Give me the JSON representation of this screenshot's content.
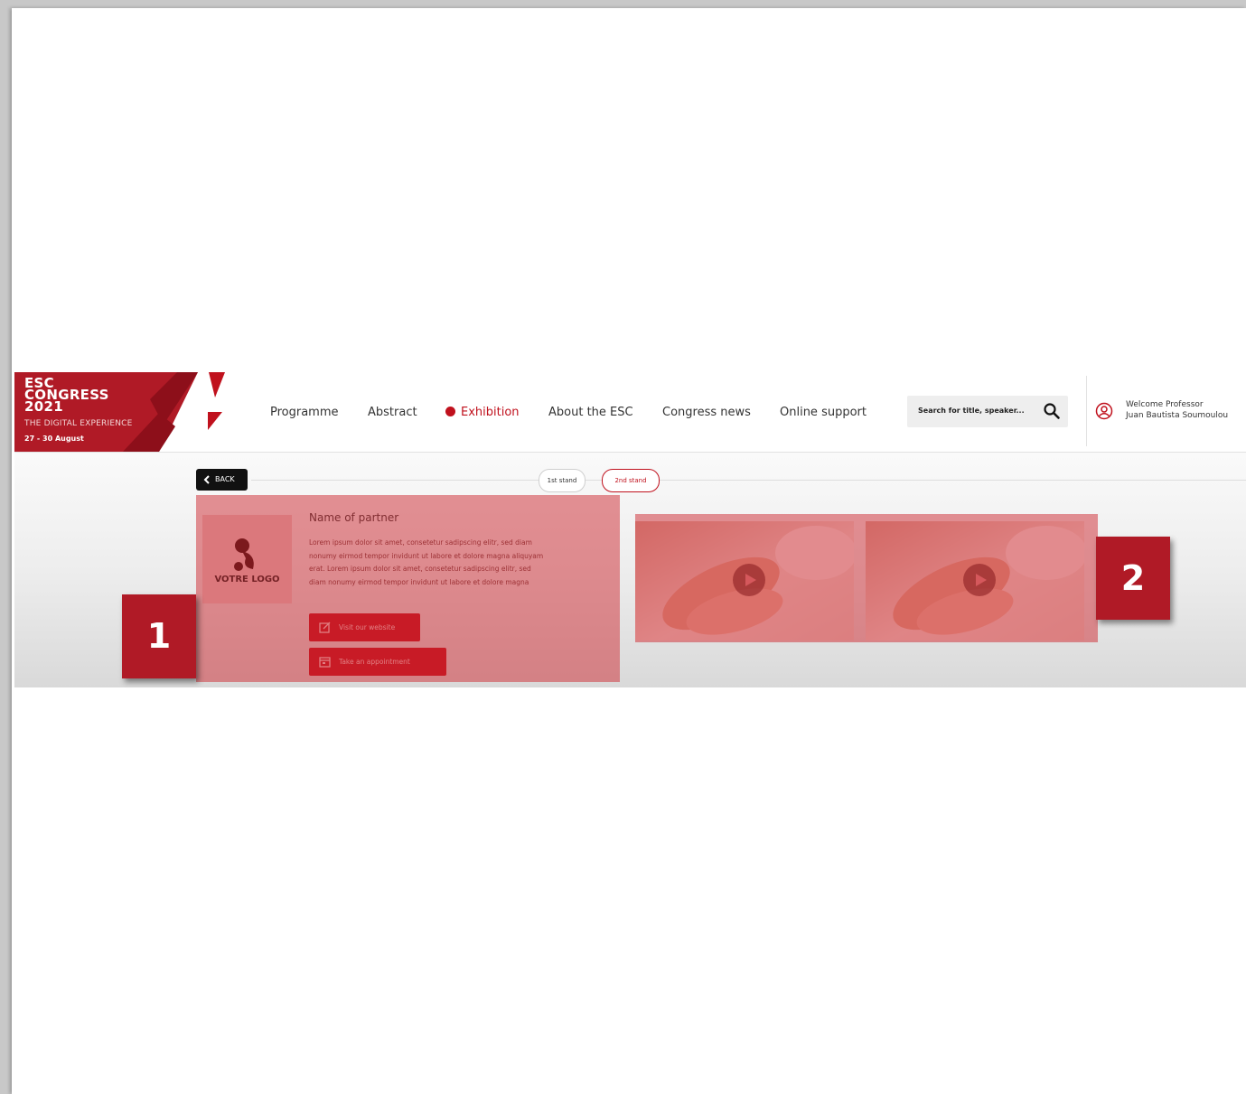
{
  "header": {
    "logo": {
      "line1": "ESC",
      "line2": "CONGRESS",
      "line3": "2021",
      "tagline": "THE DIGITAL EXPERIENCE",
      "dates": "27 - 30 August"
    },
    "nav": [
      {
        "label": "Programme"
      },
      {
        "label": "Abstract"
      },
      {
        "label": "Exhibition",
        "active": true
      },
      {
        "label": "About the ESC"
      },
      {
        "label": "Congress news"
      },
      {
        "label": "Online support"
      }
    ],
    "search": {
      "placeholder": "Search for title, speaker..."
    },
    "user": {
      "welcome": "Welcome Professor",
      "name": "Juan Bautista Soumoulou"
    }
  },
  "subbar": {
    "back_label": "BACK",
    "stand_tabs": [
      {
        "label": "1st stand"
      },
      {
        "label": "2nd stand",
        "active": true
      }
    ]
  },
  "partner": {
    "logo_text": "VOTRE LOGO",
    "name": "Name of partner",
    "description": "Lorem ipsum dolor sit amet, consetetur sadipscing elitr, sed diam nonumy eirmod tempor invidunt ut labore et dolore magna aliquyam erat. Lorem ipsum dolor sit amet, consetetur sadipscing elitr, sed diam nonumy eirmod tempor invidunt ut labore et dolore magna",
    "website_button": "Visit our website",
    "appointment_button": "Take an appointment"
  },
  "videos": [
    {
      "icon": "play-icon"
    },
    {
      "icon": "play-icon"
    }
  ],
  "annotations": {
    "marker1": "1",
    "marker2": "2"
  },
  "colors": {
    "brand_red": "#c0111d",
    "highlight_overlay": "#cd2830",
    "marker": "#b01a26"
  }
}
